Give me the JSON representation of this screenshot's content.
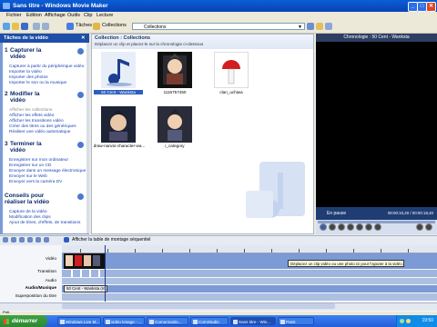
{
  "window": {
    "title": "Sans titre - Windows Movie Maker"
  },
  "menu": [
    "Fichier",
    "Edition",
    "Affichage",
    "Outils",
    "Clip",
    "Lecture"
  ],
  "toolbar": {
    "tasks_label": "Tâches",
    "collections_label": "Collections",
    "collection_value": "Collections"
  },
  "task_pane": {
    "title": "Tâches de la vidéo",
    "sections": [
      {
        "number": "1",
        "title_line1": "Capturer la",
        "title_line2": "vidéo",
        "links": [
          "Capturer à partir du périphérique vidéo",
          "Importer la vidéo",
          "Importer des photos",
          "Importer le son ou la musique"
        ]
      },
      {
        "number": "2",
        "title_line1": "Modifier la",
        "title_line2": "vidéo",
        "links": [
          "Afficher les collections",
          "Afficher les effets vidéo",
          "Afficher les transitions vidéo",
          "Créer des titres ou des génériques",
          "Réaliser une vidéo automatique"
        ]
      },
      {
        "number": "3",
        "title_line1": "Terminer la",
        "title_line2": "vidéo",
        "links": [
          "Enregistrer sur mon ordinateur",
          "Enregistrer sur un CD",
          "Envoyer dans un message électronique",
          "Envoyer sur le Web",
          "Envoyer vers la caméra DV"
        ]
      },
      {
        "number": "",
        "title_line1": "Conseils pour",
        "title_line2": "réaliser la vidéo",
        "links": [
          "Capture de la vidéo",
          "Modification des clips",
          "Ajout de titres, d'effets, de transitions"
        ]
      }
    ]
  },
  "collection": {
    "title": "Collection : Collections",
    "subtitle": "Déplacez un clip et placez-le sur la chronologie ci-dessous",
    "items": [
      {
        "label": "50 Cent - Wanksta",
        "kind": "music"
      },
      {
        "label": "1116757450",
        "kind": "image"
      },
      {
        "label": "clan_uchiwa",
        "kind": "image"
      },
      {
        "label": "draw-naruto-character-wa...",
        "kind": "image"
      },
      {
        "label": "i_category",
        "kind": "image"
      }
    ]
  },
  "preview": {
    "title": "Chronologie : 50 Cent - Wanksta",
    "status": "En pause",
    "time": "00:00:10,40 / 00:00:18,40"
  },
  "storyboard": {
    "toggle_label": "Afficher la table de montage séquentiel"
  },
  "timeline": {
    "tracks": [
      "Vidéo",
      "Transition",
      "Audio",
      "Audio/Musique",
      "Superposition du titre"
    ],
    "audio_clip": "50 Cent - Wanksta (m...",
    "hint": "Déplacez un clip vidéo ou une photo ici pour l'ajouter à la vidéo."
  },
  "statusbar": {
    "text": "Prêt"
  },
  "taskbar": {
    "start": "démarrer",
    "buttons": [
      "Windows Live M...",
      "vidéo lesage - ...",
      "Comunicatio...",
      "ComStudio",
      "Sans titre - Win...",
      "Paint"
    ],
    "clock": "19:50"
  }
}
